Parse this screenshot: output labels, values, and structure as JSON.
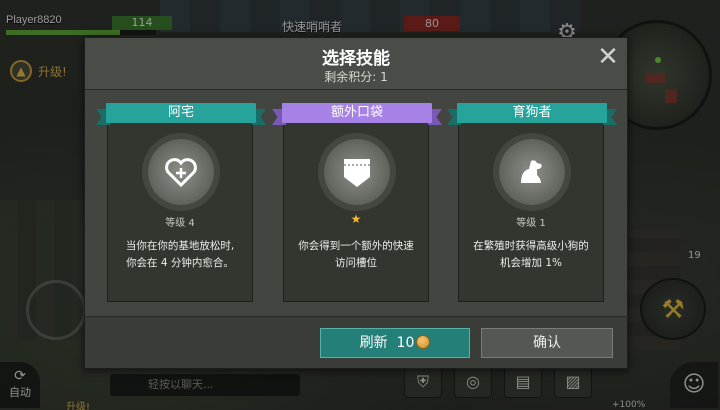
{
  "hud": {
    "player_name": "Player8820",
    "hp_value": "114",
    "hp_fill": 0.76,
    "location_title": "快速哨哨者",
    "enemy_value": "80",
    "upgrade_label": "升级!",
    "upgrade_label_bottom": "升级!",
    "auto_label": "自动",
    "chat_placeholder": "轻按以聊天...",
    "right_count": "19",
    "percent": "+100%"
  },
  "modal": {
    "title": "选择技能",
    "points_label": "剩余积分:  1",
    "close_symbol": "✕",
    "cards": [
      {
        "name": "阿宅",
        "ribbon_color": "#26a39a",
        "icon": "heart-plus-icon",
        "level": "等级 4",
        "desc_line1": "当你在你的基地放松时,",
        "desc_line2": "你会在 4 分钟内愈合。"
      },
      {
        "name": "额外口袋",
        "ribbon_color": "#a782e6",
        "icon": "pocket-icon",
        "level_star": "★",
        "desc_line1": "你会得到一个额外的快速",
        "desc_line2": "访问槽位"
      },
      {
        "name": "育狗者",
        "ribbon_color": "#26a39a",
        "icon": "dog-icon",
        "level": "等级 1",
        "desc_line1": "在繁殖时获得高级小狗的",
        "desc_line2": "机会增加 1%"
      }
    ],
    "refresh_label": "刷新",
    "refresh_cost": "10",
    "confirm_label": "确认"
  },
  "colors": {
    "teal": "#26a39a",
    "purple": "#a782e6",
    "refresh_button": "#237f78",
    "panel": "#434541"
  }
}
